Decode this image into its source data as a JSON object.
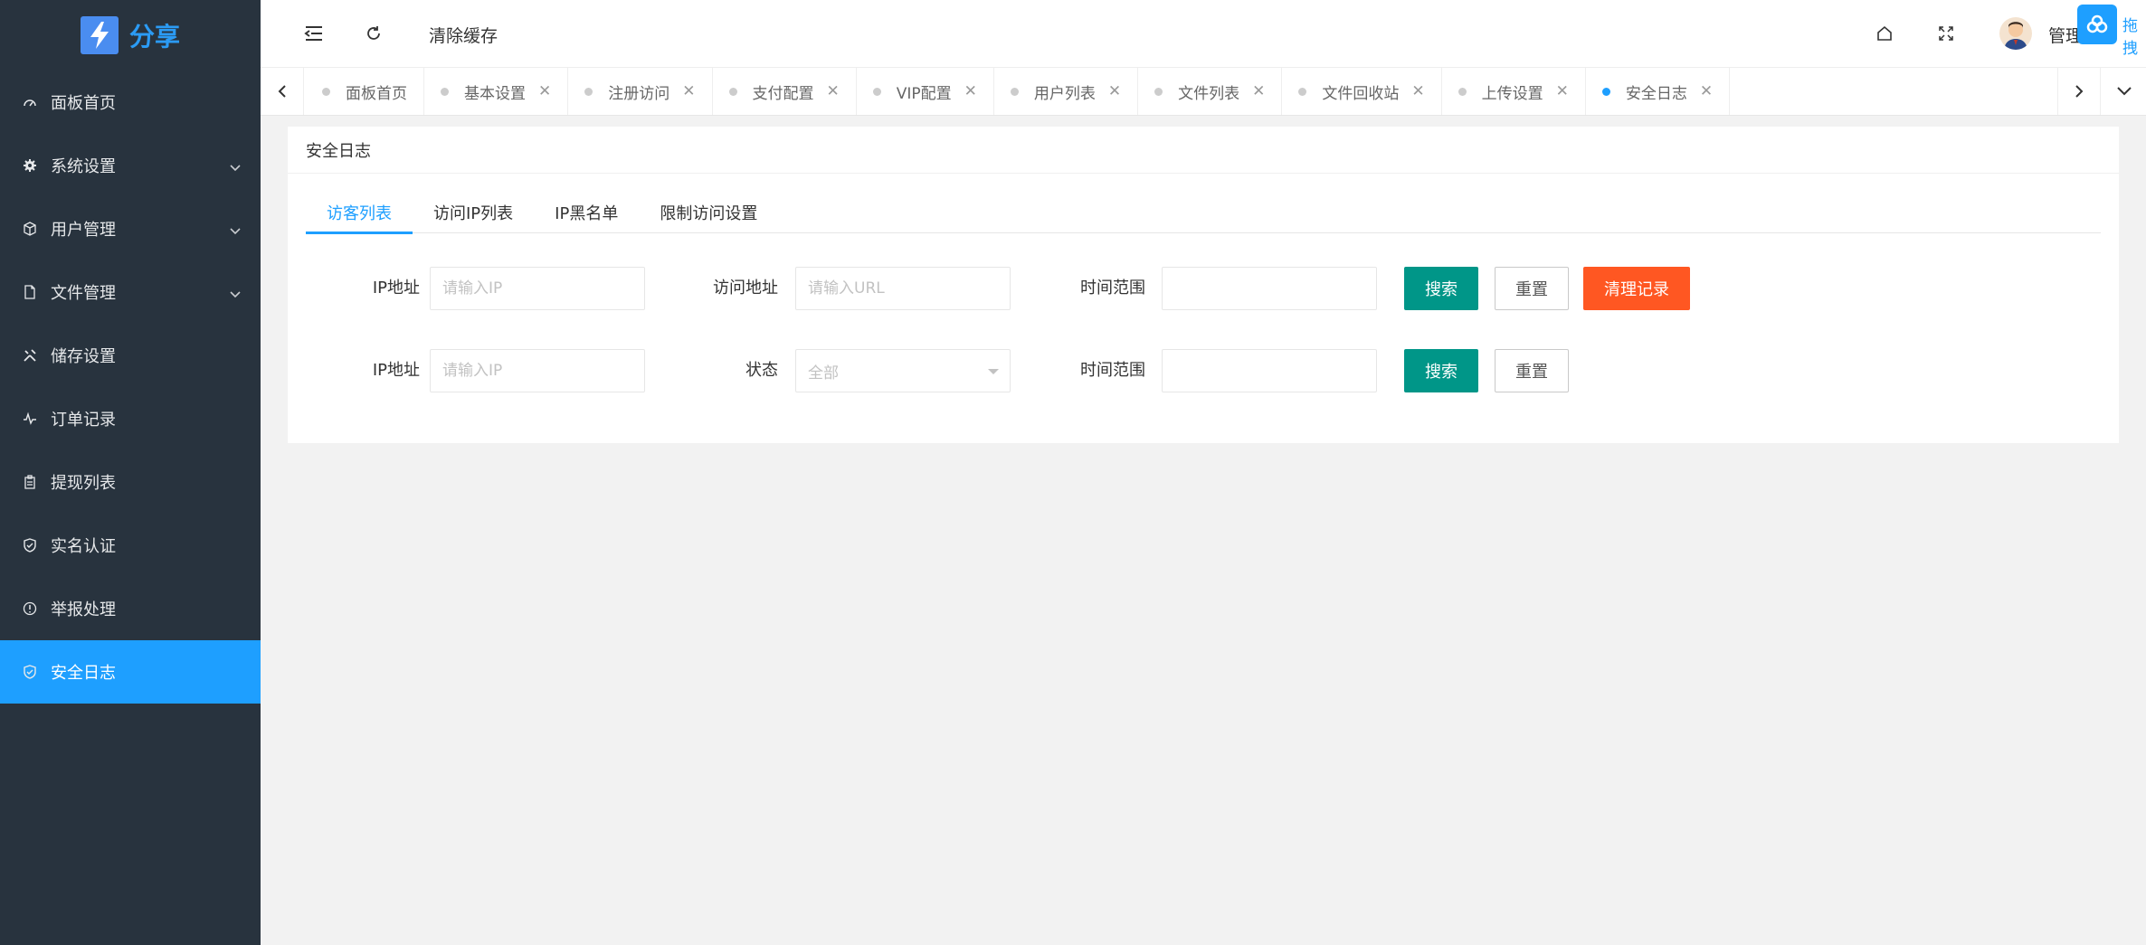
{
  "brand": {
    "name": "分享"
  },
  "sidebar": {
    "items": [
      {
        "label": "面板首页",
        "icon": "dashboard-icon",
        "expandable": false
      },
      {
        "label": "系统设置",
        "icon": "gear-icon",
        "expandable": true
      },
      {
        "label": "用户管理",
        "icon": "cube-icon",
        "expandable": true
      },
      {
        "label": "文件管理",
        "icon": "file-icon",
        "expandable": true
      },
      {
        "label": "储存设置",
        "icon": "tools-icon",
        "expandable": false
      },
      {
        "label": "订单记录",
        "icon": "pulse-icon",
        "expandable": false
      },
      {
        "label": "提现列表",
        "icon": "clipboard-icon",
        "expandable": false
      },
      {
        "label": "实名认证",
        "icon": "shield-check-icon",
        "expandable": false
      },
      {
        "label": "举报处理",
        "icon": "alert-circle-icon",
        "expandable": false
      },
      {
        "label": "安全日志",
        "icon": "shield-check-icon",
        "expandable": false,
        "active": true
      }
    ]
  },
  "header": {
    "clear_cache": "清除缓存",
    "user_name": "管理",
    "float_text": "拖拽"
  },
  "tabs": [
    {
      "label": "面板首页",
      "closable": false
    },
    {
      "label": "基本设置",
      "closable": true
    },
    {
      "label": "注册访问",
      "closable": true
    },
    {
      "label": "支付配置",
      "closable": true
    },
    {
      "label": "VIP配置",
      "closable": true
    },
    {
      "label": "用户列表",
      "closable": true
    },
    {
      "label": "文件列表",
      "closable": true
    },
    {
      "label": "文件回收站",
      "closable": true
    },
    {
      "label": "上传设置",
      "closable": true
    },
    {
      "label": "安全日志",
      "closable": true,
      "active": true
    }
  ],
  "card": {
    "title": "安全日志",
    "subtabs": [
      "访客列表",
      "访问IP列表",
      "IP黑名单",
      "限制访问设置"
    ],
    "row1": {
      "ip_label": "IP地址",
      "ip_placeholder": "请输入IP",
      "url_label": "访问地址",
      "url_placeholder": "请输入URL",
      "time_label": "时间范围",
      "search": "搜索",
      "reset": "重置",
      "clear": "清理记录"
    },
    "row2": {
      "ip_label": "IP地址",
      "ip_placeholder": "请输入IP",
      "status_label": "状态",
      "status_value": "全部",
      "time_label": "时间范围",
      "search": "搜索",
      "reset": "重置"
    }
  },
  "colors": {
    "sidebar_bg": "#28333e",
    "accent": "#1e9fff",
    "green": "#009688",
    "orange": "#ff5722"
  }
}
